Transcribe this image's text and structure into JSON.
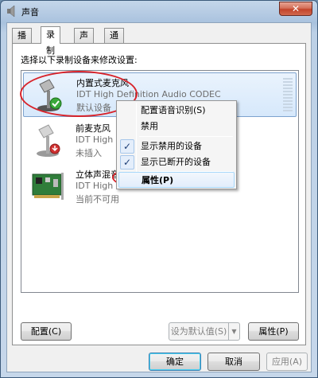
{
  "window": {
    "title": "声音",
    "close_glyph": "✕"
  },
  "tabs": [
    {
      "label": "播放"
    },
    {
      "label": "录制"
    },
    {
      "label": "声音"
    },
    {
      "label": "通信"
    }
  ],
  "instruction": "选择以下录制设备来修改设置:",
  "devices": [
    {
      "name": "内置式麦克风",
      "desc": "IDT High Definition Audio CODEC",
      "status": "默认设备",
      "icon": "microphone-icon",
      "badge": "green-check-badge"
    },
    {
      "name": "前麦克风",
      "desc": "IDT High Defin",
      "status": "未插入",
      "icon": "microphone-icon",
      "badge": "red-down-arrow-badge"
    },
    {
      "name": "立体声混音",
      "desc": "IDT High Defin",
      "status": "当前不可用",
      "icon": "sound-card-icon",
      "badge": ""
    }
  ],
  "context_menu": {
    "items": [
      {
        "label": "配置语音识别(S)"
      },
      {
        "label": "禁用"
      },
      {
        "label": "显示禁用的设备",
        "checked": "✓"
      },
      {
        "label": "显示已断开的设备",
        "checked": "✓"
      },
      {
        "label": "属性(P)"
      }
    ]
  },
  "panel_buttons": {
    "configure": "配置(C)",
    "set_default": "设为默认值(S)",
    "properties": "属性(P)"
  },
  "dialog_buttons": {
    "ok": "确定",
    "cancel": "取消",
    "apply": "应用(A)"
  },
  "colors": {
    "highlight_circle": "#d8232a",
    "selection": "#d6e8fb"
  }
}
